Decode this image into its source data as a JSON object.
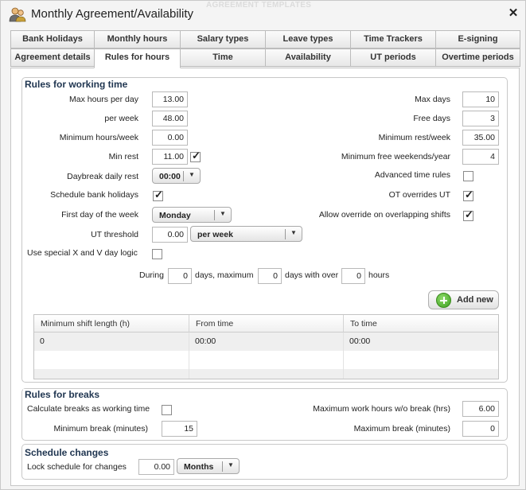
{
  "window": {
    "title": "Monthly Agreement/Availability",
    "background_title": "AGREEMENT TEMPLATES",
    "close_glyph": "✕"
  },
  "tabs_row1": [
    "Bank Holidays",
    "Monthly hours",
    "Salary types",
    "Leave types",
    "Time Trackers",
    "E-signing"
  ],
  "tabs_row2": [
    "Agreement details",
    "Rules for hours",
    "Time",
    "Availability",
    "UT periods",
    "Overtime periods"
  ],
  "active_tab": "Rules for hours",
  "working_time": {
    "title": "Rules for working time",
    "max_hours_per_day": {
      "label": "Max hours per day",
      "value": "13.00"
    },
    "per_week": {
      "label": "per week",
      "value": "48.00"
    },
    "min_hours_week": {
      "label": "Minimum hours/week",
      "value": "0.00"
    },
    "min_rest": {
      "label": "Min rest",
      "value": "11.00",
      "checked": true
    },
    "daybreak": {
      "label": "Daybreak daily rest",
      "value": "00:00"
    },
    "schedule_bank_holidays": {
      "label": "Schedule bank holidays",
      "checked": true
    },
    "first_day": {
      "label": "First day of the week",
      "value": "Monday"
    },
    "ut_threshold": {
      "label": "UT threshold",
      "value": "0.00",
      "unit": "per week"
    },
    "special_xv": {
      "label": "Use special X and V day logic",
      "checked": false
    },
    "max_days": {
      "label": "Max days",
      "value": "10"
    },
    "free_days": {
      "label": "Free days",
      "value": "3"
    },
    "min_rest_week": {
      "label": "Minimum rest/week",
      "value": "35.00"
    },
    "min_free_weekends": {
      "label": "Minimum free weekends/year",
      "value": "4"
    },
    "advanced_rules": {
      "label": "Advanced time rules",
      "checked": false
    },
    "ot_overrides_ut": {
      "label": "OT overrides UT",
      "checked": true
    },
    "allow_override": {
      "label": "Allow override on overlapping shifts",
      "checked": true
    },
    "during": {
      "label_during": "During",
      "days_value": "0",
      "label_days_max": "days, maximum",
      "max_value": "0",
      "label_days_over": "days with over",
      "hours_value": "0",
      "label_hours": "hours"
    },
    "add_new_label": "Add new",
    "shift_table": {
      "columns": [
        "Minimum shift length (h)",
        "From time",
        "To time"
      ],
      "rows": [
        [
          "0",
          "00:00",
          "00:00"
        ]
      ]
    }
  },
  "breaks": {
    "title": "Rules for breaks",
    "calc_as_working": {
      "label": "Calculate breaks as working time",
      "checked": false
    },
    "min_break": {
      "label": "Minimum break (minutes)",
      "value": "15"
    },
    "max_work_hours": {
      "label": "Maximum work hours w/o break (hrs)",
      "value": "6.00"
    },
    "max_break": {
      "label": "Maximum break (minutes)",
      "value": "0"
    }
  },
  "schedule_changes": {
    "title": "Schedule changes",
    "lock": {
      "label": "Lock schedule for changes",
      "value": "0.00",
      "unit": "Months"
    }
  }
}
